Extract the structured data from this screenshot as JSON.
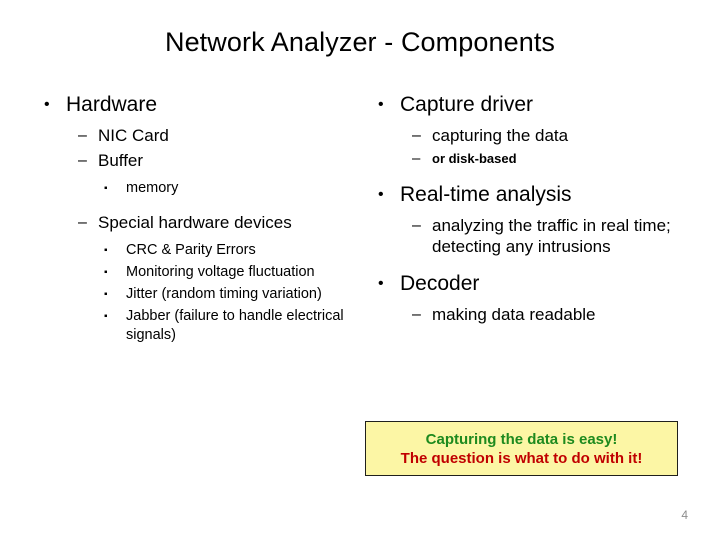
{
  "slide": {
    "title": "Network Analyzer - Components",
    "number": "4"
  },
  "left_column": {
    "items": [
      {
        "level": 1,
        "bullet": "•",
        "text": "Hardware"
      },
      {
        "level": 2,
        "bullet": "–",
        "text": "NIC Card"
      },
      {
        "level": 2,
        "bullet": "–",
        "text": "Buffer"
      },
      {
        "level": 3,
        "bullet": "▪",
        "text": "memory"
      },
      {
        "level": 2,
        "bullet": "–",
        "text": "Special hardware devices"
      },
      {
        "level": 3,
        "bullet": "▪",
        "text": "CRC & Parity Errors"
      },
      {
        "level": 3,
        "bullet": "▪",
        "text": "Monitoring voltage fluctuation"
      },
      {
        "level": 3,
        "bullet": "▪",
        "text": "Jitter (random timing variation)"
      },
      {
        "level": 3,
        "bullet": "▪",
        "text": "Jabber (failure to handle electrical signals)"
      }
    ]
  },
  "right_column": {
    "items": [
      {
        "level": 1,
        "bullet": "•",
        "text": "Capture driver"
      },
      {
        "level": 2,
        "bullet": "–",
        "text": "capturing the data"
      },
      {
        "level": 2,
        "bullet": "–",
        "text": "or disk-based"
      },
      {
        "level": 1,
        "bullet": "•",
        "text": "Real-time analysis"
      },
      {
        "level": 2,
        "bullet": "–",
        "text": "analyzing the traffic in real time; detecting any intrusions"
      },
      {
        "level": 1,
        "bullet": "•",
        "text": "Decoder"
      },
      {
        "level": 2,
        "bullet": "–",
        "text": "making data readable"
      }
    ]
  },
  "callout": {
    "line_1": "Capturing the data is easy!",
    "line_2": "The question is what to do with it!",
    "background_color": "#FCF6A5",
    "border_color": "#20201C",
    "line_1_color": "#1E8A1E",
    "line_2_color": "#C00000"
  }
}
